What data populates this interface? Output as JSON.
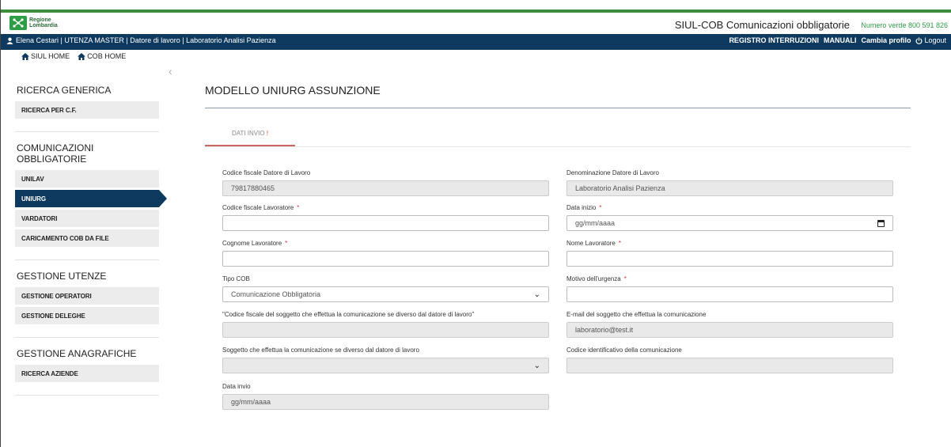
{
  "header": {
    "logo_line1": "Regione",
    "logo_line2": "Lombardia",
    "app_title_strong": "SIUL-COB",
    "app_title_rest": " Comunicazioni obbligatorie",
    "numero_verde": "Numero verde 800 591 826"
  },
  "navbar": {
    "user": "Elena Cestari | UTENZA MASTER | Datore di lavoro | Laboratorio Analisi Pazienza",
    "registro": "REGISTRO INTERRUZIONI",
    "manuali": "MANUALI",
    "cambia": "Cambia profilo",
    "logout": "Logout"
  },
  "breadcrumbs": {
    "siul_home": "SIUL HOME",
    "cob_home": "COB HOME"
  },
  "sidebar": {
    "ricerca_title": "RICERCA GENERICA",
    "ricerca_cf": "RICERCA PER C.F.",
    "com_title": "COMUNICAZIONI OBBLIGATORIE",
    "unilav": "UNILAV",
    "uniurg": "UNIURG",
    "vardatori": "VARDATORI",
    "caricamento": "CARICAMENTO COB DA FILE",
    "utenze_title": "GESTIONE UTENZE",
    "operatori": "GESTIONE OPERATORI",
    "deleghe": "GESTIONE DELEGHE",
    "anagrafiche_title": "GESTIONE ANAGRAFICHE",
    "aziende": "RICERCA AZIENDE"
  },
  "main": {
    "title": "MODELLO UNIURG ASSUNZIONE",
    "tab_label": "DATI INVIO",
    "tab_flag": "!",
    "required_mark": "*",
    "fields": {
      "cf_datore_label": "Codice fiscale Datore di Lavoro",
      "cf_datore_value": "79817880465",
      "denominazione_label": "Denominazione Datore di Lavoro",
      "denominazione_value": "Laboratorio Analisi Pazienza",
      "cf_lavoratore_label": "Codice fiscale Lavoratore",
      "data_inizio_label": "Data inizio",
      "data_inizio_placeholder": "gg/mm/aaaa",
      "cognome_label": "Cognome Lavoratore",
      "nome_label": "Nome Lavoratore",
      "tipo_cob_label": "Tipo COB",
      "tipo_cob_value": "Comunicazione Obbligatoria",
      "motivo_label": "Motivo dell'urgenza",
      "cf_soggetto_label": "\"Codice fiscale del soggetto che effettua la comunicazione se diverso dal datore di lavoro\"",
      "email_label": "E-mail del soggetto che effettua la comunicazione",
      "email_value": "laboratorio@test.it",
      "soggetto_label": "Soggetto che effettua la comunicazione se diverso dal datore di lavoro",
      "codice_id_label": "Codice identificativo della comunicazione",
      "data_invio_label": "Data invio",
      "data_invio_value": "gg/mm/aaaa"
    }
  },
  "colors": {
    "navy": "#0f3a5f",
    "green": "#2e9e46",
    "required": "#dd3333"
  }
}
